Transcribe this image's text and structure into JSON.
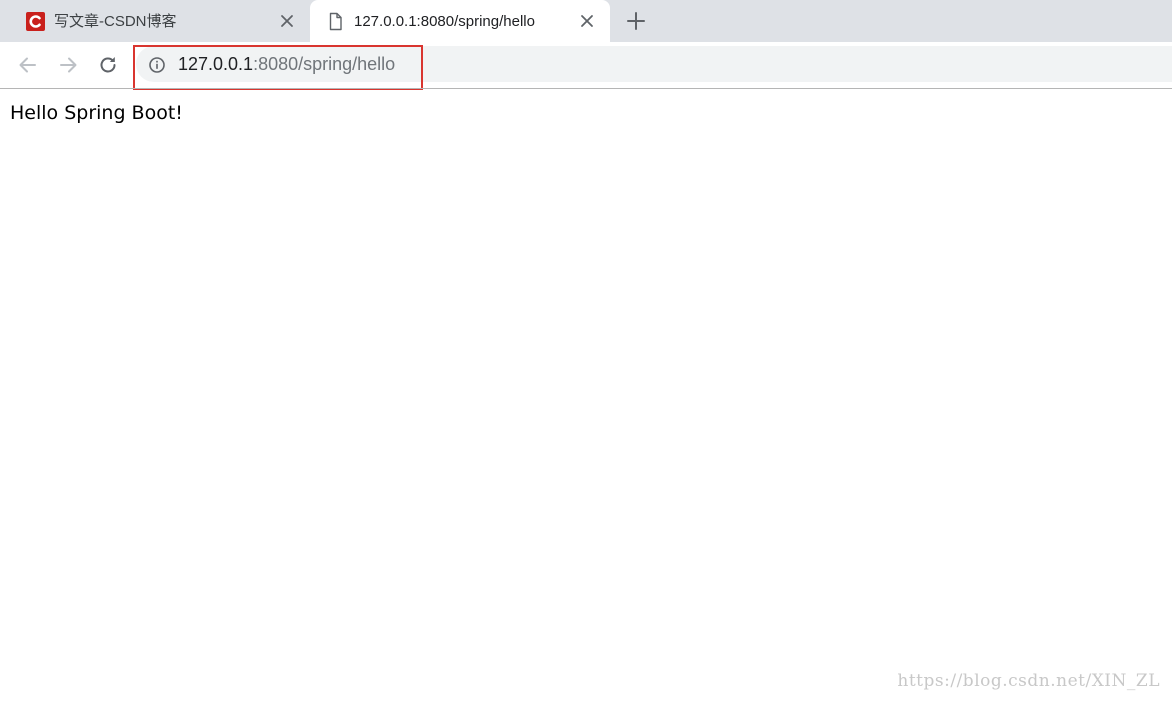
{
  "tabs": [
    {
      "title": "写文章-CSDN博客",
      "icon": "csdn-logo-icon",
      "active": false
    },
    {
      "title": "127.0.0.1:8080/spring/hello",
      "icon": "document-icon",
      "active": true
    }
  ],
  "toolbar": {
    "url_host": "127.0.0.1",
    "url_rest": ":8080/spring/hello",
    "info_icon": "info-circle-icon"
  },
  "page": {
    "body_text": "Hello Spring Boot!"
  },
  "watermark": "https://blog.csdn.net/XIN_ZL",
  "colors": {
    "tabstrip_bg": "#dee1e6",
    "omnibox_bg": "#f1f3f4",
    "highlight_border": "#d9352f",
    "csdn_red": "#c9201c"
  }
}
